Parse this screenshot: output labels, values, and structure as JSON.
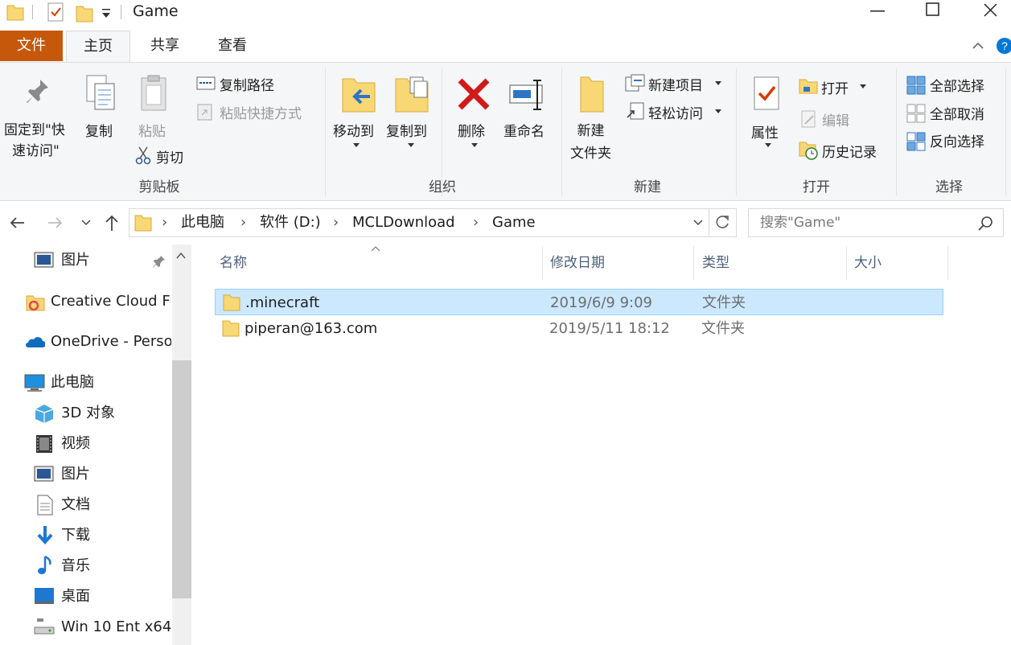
{
  "window": {
    "title": "Game",
    "minimize": "—",
    "maximize": "☐",
    "close": "✕"
  },
  "ribbon_tabs": {
    "file": "文件",
    "home": "主页",
    "share": "共享",
    "view": "查看"
  },
  "clipboard": {
    "pin_line1": "固定到\"快",
    "pin_line2": "速访问\"",
    "copy": "复制",
    "paste": "粘贴",
    "copy_path": "复制路径",
    "paste_shortcut": "粘贴快捷方式",
    "cut": "剪切",
    "group": "剪贴板"
  },
  "organize": {
    "move_to": "移动到",
    "copy_to": "复制到",
    "delete": "删除",
    "rename": "重命名",
    "group": "组织"
  },
  "new": {
    "new_folder_line1": "新建",
    "new_folder_line2": "文件夹",
    "new_item": "新建项目",
    "easy_access": "轻松访问",
    "group": "新建"
  },
  "open": {
    "properties": "属性",
    "open": "打开",
    "edit": "编辑",
    "history": "历史记录",
    "group": "打开"
  },
  "select": {
    "select_all": "全部选择",
    "select_none": "全部取消",
    "invert": "反向选择",
    "group": "选择"
  },
  "address": {
    "crumbs": [
      "此电脑",
      "软件 (D:)",
      "MCLDownload",
      "Game"
    ]
  },
  "search": {
    "placeholder": "搜索\"Game\""
  },
  "nav": {
    "pictures_pinned": "图片",
    "creative_cloud": "Creative Cloud F",
    "onedrive": "OneDrive - Perso",
    "this_pc": "此电脑",
    "objects3d": "3D 对象",
    "videos": "视频",
    "pictures": "图片",
    "documents": "文档",
    "downloads": "下载",
    "music": "音乐",
    "desktop": "桌面",
    "drive": "Win 10 Ent x64"
  },
  "columns": {
    "name": "名称",
    "date": "修改日期",
    "type": "类型",
    "size": "大小"
  },
  "files": [
    {
      "name": ".minecraft",
      "date": "2019/6/9 9:09",
      "type": "文件夹",
      "selected": true
    },
    {
      "name": "piperan@163.com",
      "date": "2019/5/11 18:12",
      "type": "文件夹",
      "selected": false
    }
  ],
  "colors": {
    "file_tab": "#c5580a",
    "selection": "#cce8ff",
    "selection_border": "#99d1ff",
    "folder": "#f8d775",
    "accent": "#0078d7"
  }
}
